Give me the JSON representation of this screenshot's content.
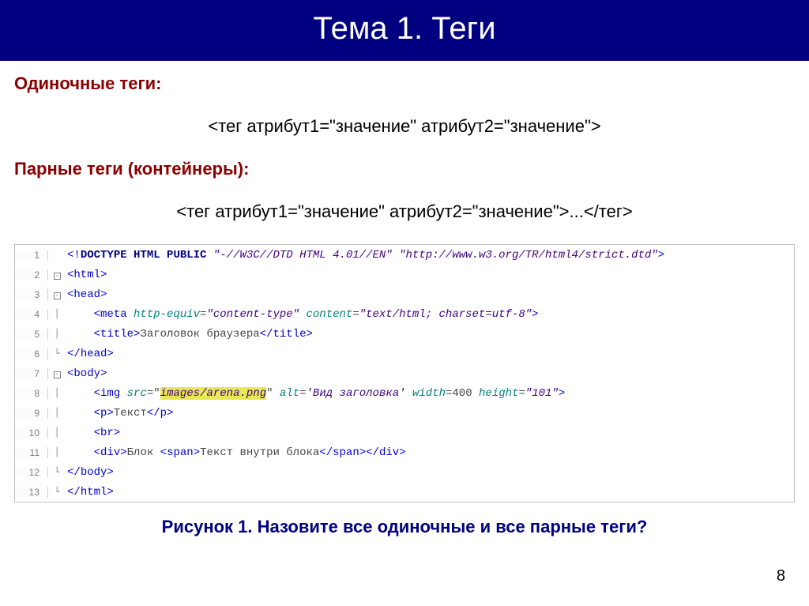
{
  "header": "Тема 1. Теги",
  "section1": "Одиночные теги:",
  "syntax1": "<тег атрибут1=\"значение\" атрибут2=\"значение\">",
  "section2": "Парные теги (контейнеры):",
  "syntax2": "<тег атрибут1=\"значение\" атрибут2=\"значение\">...</тег>",
  "code": {
    "lines": [
      {
        "n": 1,
        "fold": "",
        "indent": "",
        "tokens": [
          {
            "t": "br",
            "v": "<!"
          },
          {
            "t": "caps",
            "v": "DOCTYPE"
          },
          {
            "t": "txt",
            "v": " "
          },
          {
            "t": "caps",
            "v": "HTML"
          },
          {
            "t": "txt",
            "v": " "
          },
          {
            "t": "caps",
            "v": "PUBLIC"
          },
          {
            "t": "txt",
            "v": " "
          },
          {
            "t": "str",
            "v": "\"-//W3C//DTD HTML 4.01//EN\""
          },
          {
            "t": "txt",
            "v": " "
          },
          {
            "t": "str",
            "v": "\"http://www.w3.org/TR/html4/strict.dtd\""
          },
          {
            "t": "br",
            "v": ">"
          }
        ]
      },
      {
        "n": 2,
        "fold": "open",
        "indent": "",
        "tokens": [
          {
            "t": "br",
            "v": "<"
          },
          {
            "t": "kw",
            "v": "html"
          },
          {
            "t": "br",
            "v": ">"
          }
        ]
      },
      {
        "n": 3,
        "fold": "open",
        "indent": "",
        "tokens": [
          {
            "t": "br",
            "v": "<"
          },
          {
            "t": "kw",
            "v": "head"
          },
          {
            "t": "br",
            "v": ">"
          }
        ]
      },
      {
        "n": 4,
        "fold": "line",
        "indent": "    ",
        "tokens": [
          {
            "t": "br",
            "v": "<"
          },
          {
            "t": "kw",
            "v": "meta"
          },
          {
            "t": "txt",
            "v": " "
          },
          {
            "t": "attr",
            "v": "http-equiv"
          },
          {
            "t": "eq",
            "v": "="
          },
          {
            "t": "str",
            "v": "\"content-type\""
          },
          {
            "t": "txt",
            "v": " "
          },
          {
            "t": "attr",
            "v": "content"
          },
          {
            "t": "eq",
            "v": "="
          },
          {
            "t": "str",
            "v": "\"text/html; charset=utf-8\""
          },
          {
            "t": "br",
            "v": ">"
          }
        ]
      },
      {
        "n": 5,
        "fold": "line",
        "indent": "    ",
        "tokens": [
          {
            "t": "br",
            "v": "<"
          },
          {
            "t": "kw",
            "v": "title"
          },
          {
            "t": "br",
            "v": ">"
          },
          {
            "t": "txt",
            "v": "Заголовок браузера"
          },
          {
            "t": "br",
            "v": "</"
          },
          {
            "t": "kw",
            "v": "title"
          },
          {
            "t": "br",
            "v": ">"
          }
        ]
      },
      {
        "n": 6,
        "fold": "close",
        "indent": "",
        "tokens": [
          {
            "t": "br",
            "v": "</"
          },
          {
            "t": "kw",
            "v": "head"
          },
          {
            "t": "br",
            "v": ">"
          }
        ]
      },
      {
        "n": 7,
        "fold": "open",
        "indent": "",
        "tokens": [
          {
            "t": "br",
            "v": "<"
          },
          {
            "t": "kw",
            "v": "body"
          },
          {
            "t": "br",
            "v": ">"
          }
        ]
      },
      {
        "n": 8,
        "fold": "line",
        "indent": "    ",
        "tokens": [
          {
            "t": "br",
            "v": "<"
          },
          {
            "t": "kw",
            "v": "img"
          },
          {
            "t": "txt",
            "v": " "
          },
          {
            "t": "attr",
            "v": "src"
          },
          {
            "t": "eq",
            "v": "="
          },
          {
            "t": "txt",
            "v": "\""
          },
          {
            "t": "hstr",
            "v": "images/arena.png"
          },
          {
            "t": "txt",
            "v": "\""
          },
          {
            "t": "txt",
            "v": " "
          },
          {
            "t": "attr",
            "v": "alt"
          },
          {
            "t": "eq",
            "v": "="
          },
          {
            "t": "str",
            "v": "'Вид заголовка'"
          },
          {
            "t": "txt",
            "v": " "
          },
          {
            "t": "attr",
            "v": "width"
          },
          {
            "t": "eq",
            "v": "="
          },
          {
            "t": "txt",
            "v": "400"
          },
          {
            "t": "txt",
            "v": " "
          },
          {
            "t": "attr",
            "v": "height"
          },
          {
            "t": "eq",
            "v": "="
          },
          {
            "t": "str",
            "v": "\"101\""
          },
          {
            "t": "br",
            "v": ">"
          }
        ]
      },
      {
        "n": 9,
        "fold": "line",
        "indent": "    ",
        "tokens": [
          {
            "t": "br",
            "v": "<"
          },
          {
            "t": "kw",
            "v": "p"
          },
          {
            "t": "br",
            "v": ">"
          },
          {
            "t": "txt",
            "v": "Текст"
          },
          {
            "t": "br",
            "v": "</"
          },
          {
            "t": "kw",
            "v": "p"
          },
          {
            "t": "br",
            "v": ">"
          }
        ]
      },
      {
        "n": 10,
        "fold": "line",
        "indent": "    ",
        "tokens": [
          {
            "t": "br",
            "v": "<"
          },
          {
            "t": "kw",
            "v": "br"
          },
          {
            "t": "br",
            "v": ">"
          }
        ]
      },
      {
        "n": 11,
        "fold": "line",
        "indent": "    ",
        "tokens": [
          {
            "t": "br",
            "v": "<"
          },
          {
            "t": "kw",
            "v": "div"
          },
          {
            "t": "br",
            "v": ">"
          },
          {
            "t": "txt",
            "v": "Блок "
          },
          {
            "t": "br",
            "v": "<"
          },
          {
            "t": "kw",
            "v": "span"
          },
          {
            "t": "br",
            "v": ">"
          },
          {
            "t": "txt",
            "v": "Текст внутри блока"
          },
          {
            "t": "br",
            "v": "</"
          },
          {
            "t": "kw",
            "v": "span"
          },
          {
            "t": "br",
            "v": ">"
          },
          {
            "t": "br",
            "v": "</"
          },
          {
            "t": "kw",
            "v": "div"
          },
          {
            "t": "br",
            "v": ">"
          }
        ]
      },
      {
        "n": 12,
        "fold": "close",
        "indent": "",
        "tokens": [
          {
            "t": "br",
            "v": "</"
          },
          {
            "t": "kw",
            "v": "body"
          },
          {
            "t": "br",
            "v": ">"
          }
        ]
      },
      {
        "n": 13,
        "fold": "close",
        "indent": "",
        "tokens": [
          {
            "t": "br",
            "v": "</"
          },
          {
            "t": "kw",
            "v": "html"
          },
          {
            "t": "br",
            "v": ">"
          }
        ]
      }
    ]
  },
  "caption": "Рисунок 1. Назовите все одиночные и все парные теги?",
  "pagenum": "8"
}
